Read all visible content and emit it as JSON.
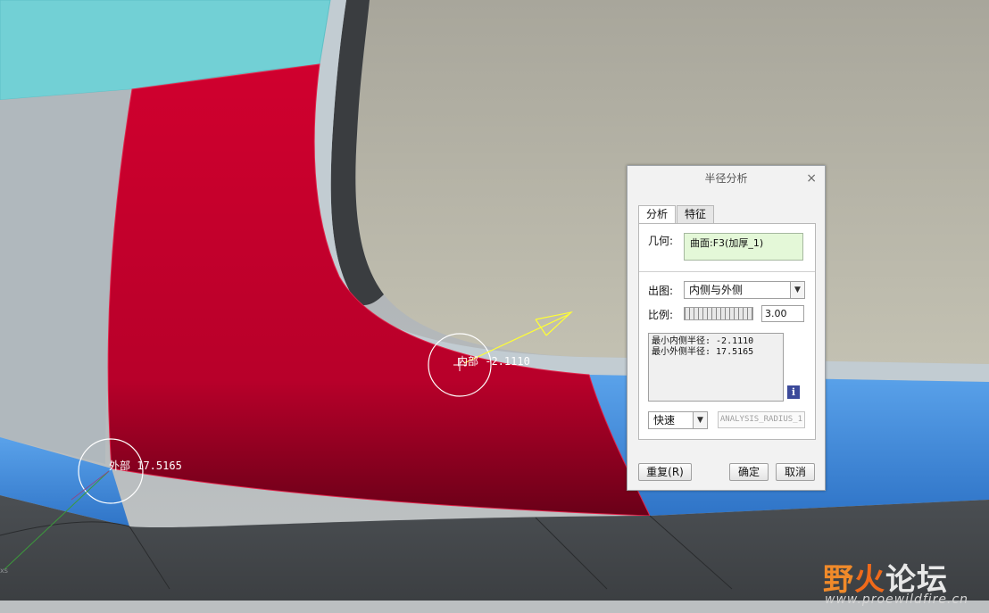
{
  "viewport": {
    "annotations": {
      "inner_radius_label": "内部 -2.1110",
      "outer_radius_label": "外部 17.5165",
      "axis_label": "xs"
    },
    "colors": {
      "background": "#aeb3b4",
      "surface_red": "#c8002d",
      "surface_teal": "#6fcfd3",
      "surface_blue": "#3f8fe0",
      "surface_tan": "#b8b6a6",
      "edge_dark": "#3a3d40",
      "edge_light": "#c9d2d8",
      "arrow_yellow": "#ffff33"
    }
  },
  "dialog": {
    "title": "半径分析",
    "close": "×",
    "tabs": [
      {
        "label": "分析",
        "active": true
      },
      {
        "label": "特征",
        "active": false
      }
    ],
    "geometry_label": "几何:",
    "geometry_value": "曲面:F3(加厚_1)",
    "plot_label": "出图:",
    "plot_value": "内侧与外侧",
    "scale_label": "比例:",
    "scale_value": "3.00",
    "results": [
      "最小内侧半径: -2.1110",
      "最小外侧半径: 17.5165"
    ],
    "info": "i",
    "mode_value": "快速",
    "feature_name": "ANALYSIS_RADIUS_1",
    "buttons": {
      "repeat": "重复(R)",
      "ok": "确定",
      "cancel": "取消"
    }
  },
  "watermark": {
    "logo_part1": "野",
    "logo_part2": "火",
    "logo_part3": "论坛",
    "url": "www.proewildfire.cn"
  }
}
